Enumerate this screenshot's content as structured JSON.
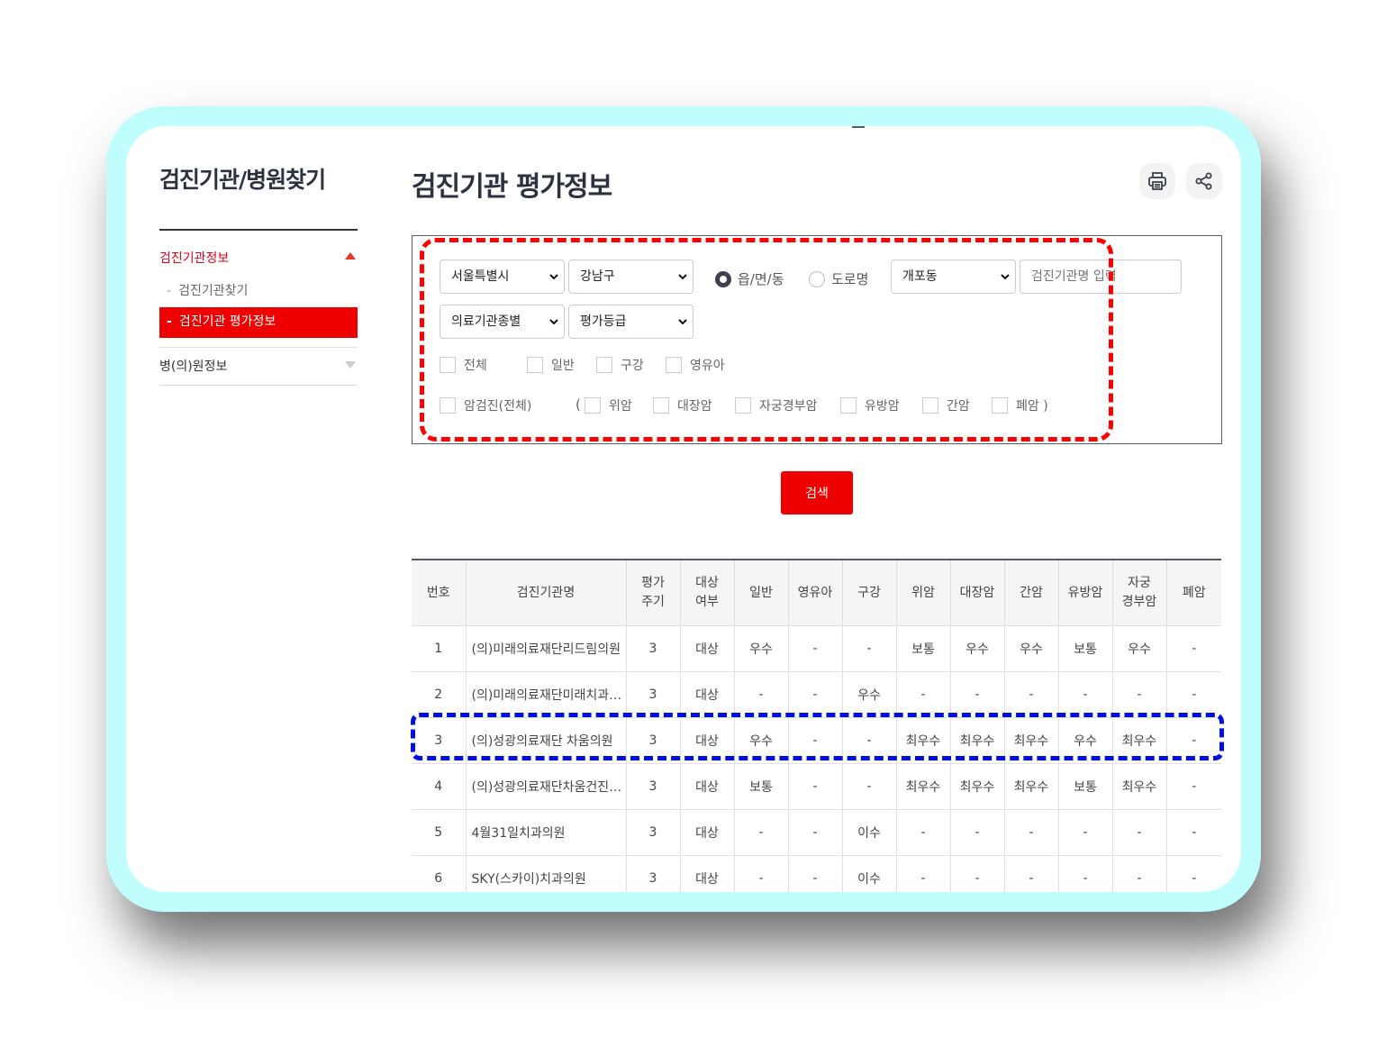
{
  "sidebar": {
    "title": "검진기관/병원찾기",
    "sections": [
      {
        "label": "검진기관정보",
        "expanded": true,
        "items": [
          {
            "label": "검진기관찾기",
            "active": false
          },
          {
            "label": "검진기관 평가정보",
            "active": true
          }
        ]
      },
      {
        "label": "병(의)원정보",
        "expanded": false
      }
    ],
    "dash": "-"
  },
  "main": {
    "title": "검진기관 평가정보",
    "actions": {
      "print": "print-icon",
      "share": "share-icon"
    },
    "filters": {
      "city": "서울특별시",
      "district": "강남구",
      "address_type": {
        "options": [
          "읍/면/동",
          "도로명"
        ],
        "selected": "읍/면/동"
      },
      "dong": "개포동",
      "name_placeholder": "검진기관명 입력",
      "institution_type": "의료기관종별",
      "grade": "평가등급",
      "checkboxes_row1": [
        "전체",
        "일반",
        "구강",
        "영유아"
      ],
      "cancer_all": "암검진(전체)",
      "paren_open": "(",
      "cancer_types": [
        "위암",
        "대장암",
        "자궁경부암",
        "유방암",
        "간암"
      ],
      "cancer_last": "폐암 )"
    },
    "search_button": "검색",
    "table": {
      "headers": [
        "번호",
        "검진기관명",
        "평가\n주기",
        "대상\n여부",
        "일반",
        "영유아",
        "구강",
        "위암",
        "대장암",
        "간암",
        "유방암",
        "자궁\n경부암",
        "폐암"
      ],
      "rows": [
        [
          "1",
          "(의)미래의료재단리드림의원",
          "3",
          "대상",
          "우수",
          "-",
          "-",
          "보통",
          "우수",
          "우수",
          "보통",
          "우수",
          "-"
        ],
        [
          "2",
          "(의)미래의료재단미래치과…",
          "3",
          "대상",
          "-",
          "-",
          "우수",
          "-",
          "-",
          "-",
          "-",
          "-",
          "-"
        ],
        [
          "3",
          "(의)성광의료재단 차움의원",
          "3",
          "대상",
          "우수",
          "-",
          "-",
          "최우수",
          "최우수",
          "최우수",
          "우수",
          "최우수",
          "-"
        ],
        [
          "4",
          "(의)성광의료재단차움건진…",
          "3",
          "대상",
          "보통",
          "-",
          "-",
          "최우수",
          "최우수",
          "최우수",
          "보통",
          "최우수",
          "-"
        ],
        [
          "5",
          "4월31일치과의원",
          "3",
          "대상",
          "-",
          "-",
          "이수",
          "-",
          "-",
          "-",
          "-",
          "-",
          "-"
        ],
        [
          "6",
          "SKY(스카이)치과의원",
          "3",
          "대상",
          "-",
          "-",
          "이수",
          "-",
          "-",
          "-",
          "-",
          "-",
          "-"
        ]
      ],
      "highlighted_row": 3
    }
  },
  "colors": {
    "accent": "#ee0000",
    "frame": "#c0fdfd",
    "annotation_red": "#ff0000",
    "annotation_blue": "#0010e0",
    "title": "#2d3240"
  }
}
